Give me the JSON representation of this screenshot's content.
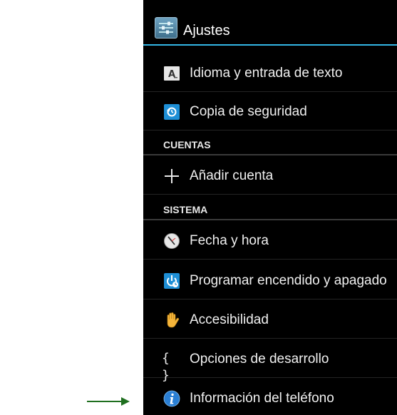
{
  "actionbar": {
    "title": "Ajustes",
    "icon": "settings-sliders-icon"
  },
  "rows_top": [
    {
      "label": "Idioma y entrada de texto",
      "icon": "keyboard-a-icon"
    },
    {
      "label": "Copia de seguridad",
      "icon": "backup-restore-icon"
    }
  ],
  "sections": {
    "accounts": "CUENTAS",
    "system": "SISTEMA"
  },
  "accounts_rows": [
    {
      "label": "Añadir cuenta",
      "icon": "plus-icon"
    }
  ],
  "system_rows": [
    {
      "label": "Fecha y hora",
      "icon": "clock-icon"
    },
    {
      "label": "Programar encendido y apagado",
      "icon": "power-schedule-icon"
    },
    {
      "label": "Accesibilidad",
      "icon": "hand-icon"
    },
    {
      "label": "Opciones de desarrollo",
      "icon": "braces-icon",
      "icon_text": "{ }"
    },
    {
      "label": "Información del teléfono",
      "icon": "info-icon"
    }
  ],
  "colors": {
    "accent": "#33b5e5",
    "background": "#000000",
    "annotation_arrow": "#1f6f1f"
  }
}
